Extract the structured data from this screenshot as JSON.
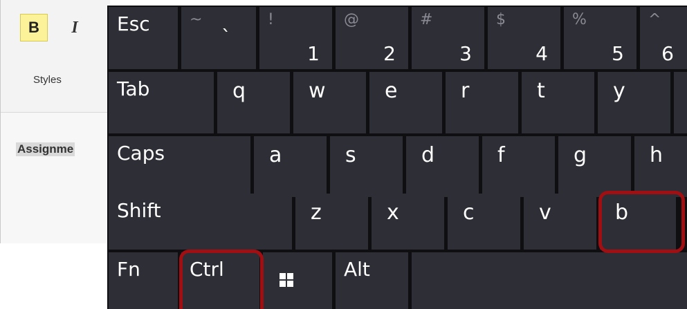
{
  "editor": {
    "bold_label": "B",
    "italic_label": "I",
    "styles_label": "Styles",
    "document_text": "Assignme"
  },
  "keyboard": {
    "row1": [
      {
        "id": "esc",
        "label": "Esc"
      },
      {
        "id": "backtick",
        "top": "~",
        "bottom": "`"
      },
      {
        "id": "1",
        "top": "!",
        "bottom": "1"
      },
      {
        "id": "2",
        "top": "@",
        "bottom": "2"
      },
      {
        "id": "3",
        "top": "#",
        "bottom": "3"
      },
      {
        "id": "4",
        "top": "$",
        "bottom": "4"
      },
      {
        "id": "5",
        "top": "%",
        "bottom": "5"
      },
      {
        "id": "6",
        "top": "^",
        "bottom": "6"
      }
    ],
    "row2": [
      "Tab",
      "q",
      "w",
      "e",
      "r",
      "t",
      "y"
    ],
    "row3": [
      "Caps",
      "a",
      "s",
      "d",
      "f",
      "g",
      "h"
    ],
    "row4": [
      "Shift",
      "z",
      "x",
      "c",
      "v",
      "b"
    ],
    "row5": [
      "Fn",
      "Ctrl",
      "windows-icon",
      "Alt",
      ""
    ]
  },
  "highlighted_keys": [
    "b",
    "Ctrl"
  ],
  "colors": {
    "key_bg": "#2e2e36",
    "keyboard_bg": "#0f0f12",
    "highlight": "#a10f12",
    "bold_bg": "#fbf29a"
  }
}
